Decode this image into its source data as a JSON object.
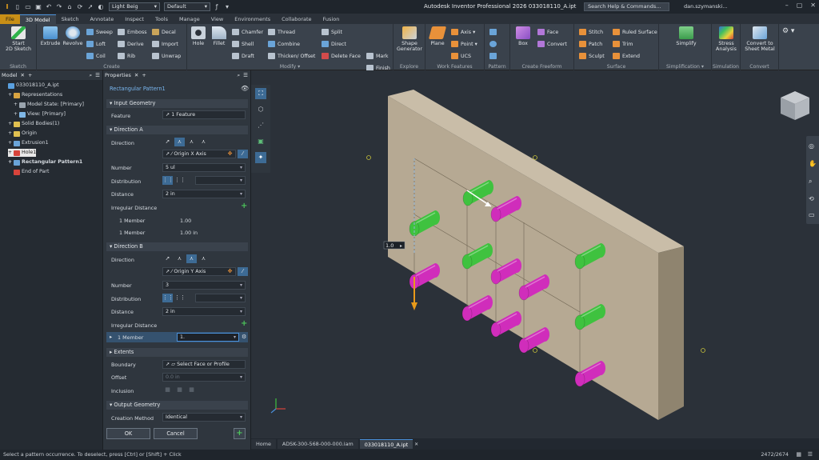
{
  "titlebar": {
    "appearance_value": "Light Beig",
    "style_value": "Default",
    "title": "Autodesk Inventor Professional 2026  033018110_A.ipt",
    "search_placeholder": "Search Help & Commands...",
    "user": "dan.szymanski..."
  },
  "ribbon_tabs": [
    "File",
    "3D Model",
    "Sketch",
    "Annotate",
    "Inspect",
    "Tools",
    "Manage",
    "View",
    "Environments",
    "Collaborate",
    "Fusion"
  ],
  "ribbon": {
    "sketch": {
      "start": "Start\n2D Sketch",
      "label": "Sketch"
    },
    "create": {
      "extrude": "Extrude",
      "revolve": "Revolve",
      "sweep": "Sweep",
      "loft": "Loft",
      "coil": "Coil",
      "emboss": "Emboss",
      "derive": "Derive",
      "rib": "Rib",
      "decal": "Decal",
      "import": "Import",
      "unwrap": "Unwrap",
      "label": "Create"
    },
    "modify": {
      "hole": "Hole",
      "fillet": "Fillet",
      "chamfer": "Chamfer",
      "shell": "Shell",
      "draft": "Draft",
      "thread": "Thread",
      "combine": "Combine",
      "thicken": "Thicken/ Offset",
      "split": "Split",
      "direct": "Direct",
      "delete_face": "Delete Face",
      "label": "Modify ▾"
    },
    "explore": {
      "mark": "Mark",
      "finish": "Finish",
      "shape_generator": "Shape\nGenerator",
      "label": "Explore"
    },
    "work": {
      "plane": "Plane",
      "axis": "Axis ▾",
      "point": "Point ▾",
      "ucs": "UCS",
      "label": "Work Features"
    },
    "pattern": {
      "label": "Pattern"
    },
    "freeform": {
      "box": "Box",
      "face": "Face",
      "convert": "Convert",
      "label": "Create Freeform"
    },
    "surface": {
      "stitch": "Stitch",
      "patch": "Patch",
      "sculpt": "Sculpt",
      "ruled": "Ruled Surface",
      "trim": "Trim",
      "extend": "Extend",
      "label": "Surface"
    },
    "simplification": {
      "simplify": "Simplify",
      "label": "Simplification ▾"
    },
    "simulation": {
      "stress": "Stress\nAnalysis",
      "label": "Simulation"
    },
    "convert": {
      "sheet_metal": "Convert to\nSheet Metal",
      "label": "Convert"
    }
  },
  "browser": {
    "title": "Model",
    "items": [
      {
        "label": "033018110_A.ipt",
        "indent": 0
      },
      {
        "label": "Representations",
        "indent": 1
      },
      {
        "label": "Model State: [Primary]",
        "indent": 2
      },
      {
        "label": "View: [Primary]",
        "indent": 2
      },
      {
        "label": "Solid Bodies(1)",
        "indent": 1
      },
      {
        "label": "Origin",
        "indent": 1
      },
      {
        "label": "Extrusion1",
        "indent": 1
      },
      {
        "label": "Hole1",
        "indent": 1
      },
      {
        "label": "Rectangular Pattern1",
        "indent": 1
      },
      {
        "label": "End of Part",
        "indent": 1
      }
    ]
  },
  "properties": {
    "title": "Properties",
    "feature_name": "Rectangular Pattern1",
    "input_geometry": "Input Geometry",
    "feature_label": "Feature",
    "feature_value": "1 Feature",
    "dirA": {
      "title": "Direction A",
      "direction_label": "Direction",
      "direction_value": "Origin X Axis",
      "number_label": "Number",
      "number_value": "5 ul",
      "distribution_label": "Distribution",
      "distance_label": "Distance",
      "distance_value": "2 in",
      "irregular_label": "Irregular Distance",
      "m1_label": "1 Member",
      "m1_value": "1.00",
      "m2_label": "1 Member",
      "m2_value": "1.00 in"
    },
    "dirB": {
      "title": "Direction B",
      "direction_label": "Direction",
      "direction_value": "Origin Y Axis",
      "number_label": "Number",
      "number_value": "3",
      "distribution_label": "Distribution",
      "distance_label": "Distance",
      "distance_value": "2 in",
      "irregular_label": "Irregular Distance",
      "m1_label": "1 Member",
      "m1_value": "1."
    },
    "extents": {
      "title": "Extents",
      "boundary_label": "Boundary",
      "boundary_value": "Select Face or Profile",
      "offset_label": "Offset",
      "offset_value": "0.0 in",
      "inclusion_label": "Inclusion"
    },
    "output": {
      "title": "Output Geometry",
      "method_label": "Creation Method",
      "method_value": "Identical"
    },
    "ok": "OK",
    "cancel": "Cancel"
  },
  "viewport": {
    "dim_value": "1.0",
    "colors": {
      "block": "#b6a993",
      "block_top": "#c9bda8",
      "block_side": "#8f846f",
      "green": "#3fc23f",
      "magenta": "#d02dbb"
    }
  },
  "doc_tabs": [
    "Home",
    "ADSK-300-568-000-000.iam",
    "033018110_A.ipt"
  ],
  "status": {
    "message": "Select a pattern occurrence.  To deselect, press [Ctrl] or [Shift] + Click",
    "count": "2472/2674"
  }
}
